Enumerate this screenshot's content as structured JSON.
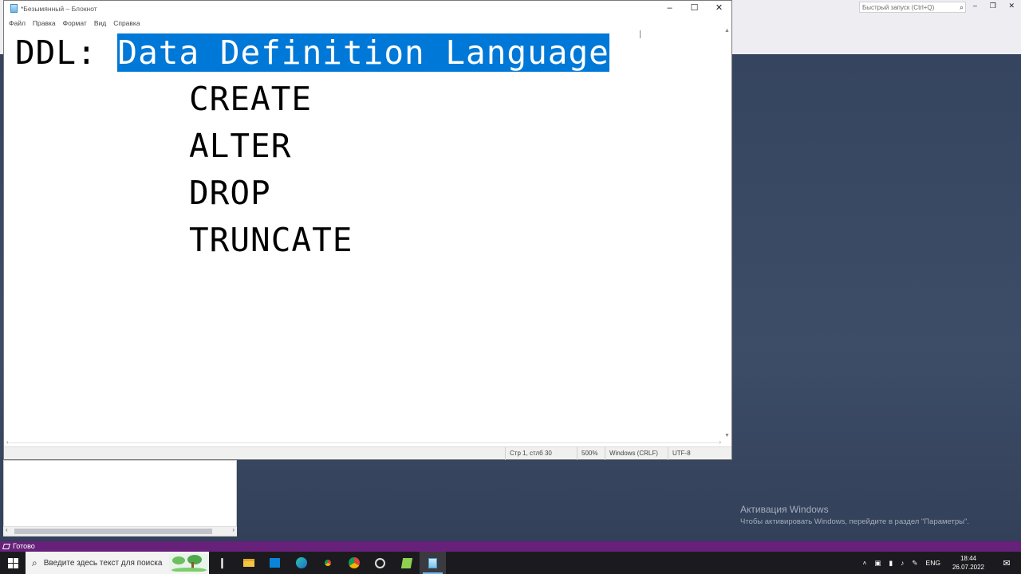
{
  "background": {
    "quick_launch_placeholder": "Быстрый запуск (Ctrl+Q)",
    "status_text": "Готово",
    "activation_title": "Активация Windows",
    "activation_text": "Чтобы активировать Windows, перейдите в раздел \"Параметры\".",
    "accent_color": "#68217a"
  },
  "notepad": {
    "title": "*Безымянный – Блокнот",
    "menu": [
      "Файл",
      "Правка",
      "Формат",
      "Вид",
      "Справка"
    ],
    "content": {
      "prefix": "DDL: ",
      "selected": "Data Definition Language",
      "commands": [
        "CREATE",
        "ALTER",
        "DROP",
        "TRUNCATE"
      ]
    },
    "status": {
      "position": "Стр 1, стлб 30",
      "zoom": "500%",
      "line_ending": "Windows (CRLF)",
      "encoding": "UTF-8"
    },
    "selection_color": "#0078d7"
  },
  "taskbar": {
    "search_placeholder": "Введите здесь текст для поиска",
    "icons": [
      "task-view-icon",
      "file-explorer-icon",
      "store-icon",
      "edge-icon",
      "chrome-beta-icon",
      "chrome-icon",
      "app-icon",
      "notepad-plus-icon",
      "notepad-icon"
    ],
    "language": "ENG",
    "time": "18:44",
    "date": "26.07.2022"
  }
}
